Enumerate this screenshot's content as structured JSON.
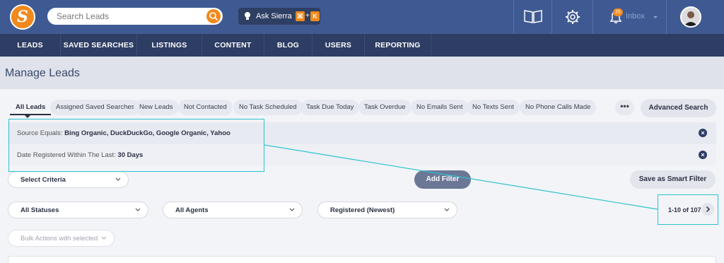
{
  "header": {
    "logo_letter": "S",
    "search_placeholder": "Search Leads",
    "ask_label": "Ask Sierra",
    "ask_key1": "⌘",
    "ask_plus": "+",
    "ask_key2": "K",
    "inbox_label": "Inbox",
    "inbox_badge": "25"
  },
  "nav": {
    "items": [
      "LEADS",
      "SAVED SEARCHES",
      "LISTINGS",
      "CONTENT",
      "BLOG",
      "USERS",
      "REPORTING"
    ]
  },
  "page": {
    "title": "Manage Leads"
  },
  "tabs": [
    "All Leads",
    "Assigned Saved Searches",
    "New Leads",
    "Not Contacted",
    "No Task Scheduled",
    "Task Due Today",
    "Task Overdue",
    "No Emails Sent",
    "No Texts Sent",
    "No Phone Calls Made"
  ],
  "more_label": "•••",
  "advanced_search_label": "Advanced Search",
  "filters": [
    {
      "prefix": "Source Equals: ",
      "value": "Bing Organic, DuckDuckGo, Google Organic, Yahoo"
    },
    {
      "prefix": "Date Registered Within The Last: ",
      "value": "30 Days"
    }
  ],
  "remove_glyph": "×",
  "select_criteria": "Select Criteria",
  "add_filter": "Add Filter",
  "save_smart_filter": "Save as Smart Filter",
  "status_select": "All Statuses",
  "agents_select": "All Agents",
  "sort_select": "Registered (Newest)",
  "pager_text": "1-10 of 107",
  "bulk_actions": "Bulk Actions with selected",
  "colors": {
    "header_bg": "#3f5a93",
    "nav_bg": "#2d3d63",
    "accent": "#f08a1c",
    "highlight": "#2bc4d0"
  }
}
